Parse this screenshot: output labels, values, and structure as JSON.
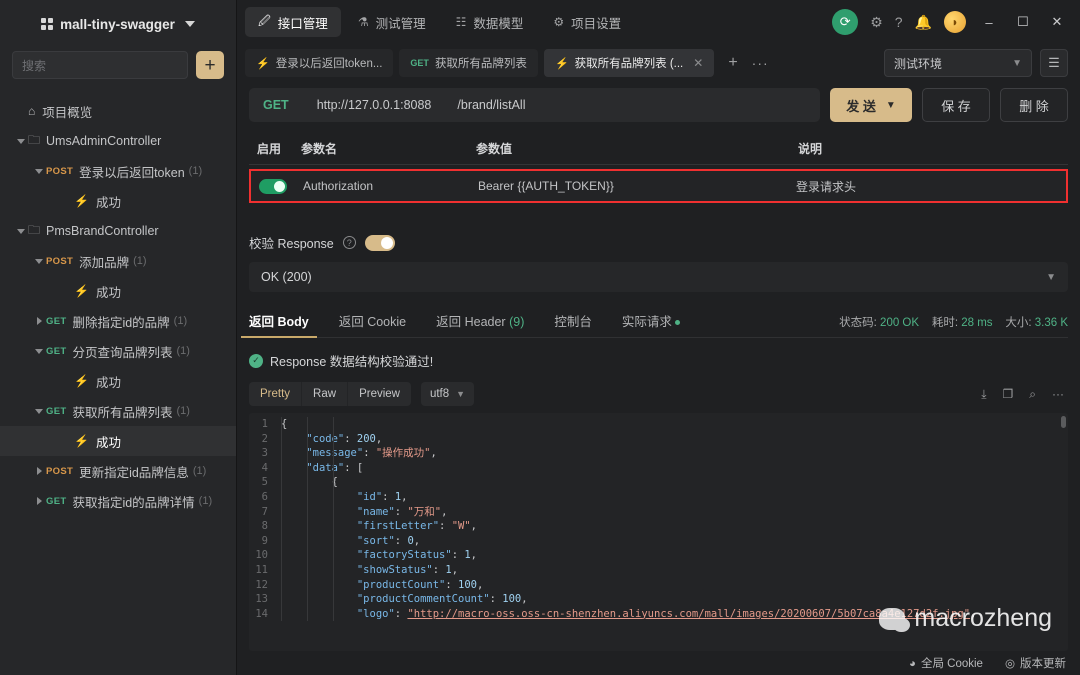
{
  "sidebar": {
    "project_name": "mall-tiny-swagger",
    "search_placeholder": "搜索",
    "add_label": "+",
    "overview_label": "项目概览",
    "tree": [
      {
        "type": "folder",
        "label": "UmsAdminController",
        "indent": 1,
        "arrow": "down"
      },
      {
        "type": "api",
        "method": "POST",
        "label": "登录以后返回token",
        "count": "(1)",
        "indent": 2,
        "arrow": "down"
      },
      {
        "type": "case",
        "label": "成功",
        "indent": 3,
        "arrow": "none"
      },
      {
        "type": "folder",
        "label": "PmsBrandController",
        "indent": 1,
        "arrow": "down"
      },
      {
        "type": "api",
        "method": "POST",
        "label": "添加品牌",
        "count": "(1)",
        "indent": 2,
        "arrow": "down"
      },
      {
        "type": "case",
        "label": "成功",
        "indent": 3,
        "arrow": "none"
      },
      {
        "type": "api",
        "method": "GET",
        "label": "删除指定id的品牌",
        "count": "(1)",
        "indent": 2,
        "arrow": "right"
      },
      {
        "type": "api",
        "method": "GET",
        "label": "分页查询品牌列表",
        "count": "(1)",
        "indent": 2,
        "arrow": "down"
      },
      {
        "type": "case",
        "label": "成功",
        "indent": 3,
        "arrow": "none"
      },
      {
        "type": "api",
        "method": "GET",
        "label": "获取所有品牌列表",
        "count": "(1)",
        "indent": 2,
        "arrow": "down"
      },
      {
        "type": "case",
        "label": "成功",
        "indent": 3,
        "arrow": "none",
        "selected": true
      },
      {
        "type": "api",
        "method": "POST",
        "label": "更新指定id品牌信息",
        "count": "(1)",
        "indent": 2,
        "arrow": "right"
      },
      {
        "type": "api",
        "method": "GET",
        "label": "获取指定id的品牌详情",
        "count": "(1)",
        "indent": 2,
        "arrow": "right"
      }
    ]
  },
  "topnav": {
    "items": [
      {
        "label": "接口管理",
        "icon": "link-icon",
        "active": true
      },
      {
        "label": "测试管理",
        "icon": "flask-icon",
        "active": false
      },
      {
        "label": "数据模型",
        "icon": "model-icon",
        "active": false
      },
      {
        "label": "项目设置",
        "icon": "gear-icon",
        "active": false
      }
    ],
    "window": {
      "minimize": "–",
      "maximize": "☐",
      "close": "✕"
    }
  },
  "doctabs": {
    "tabs": [
      {
        "label": "登录以后返回token...",
        "kind": "case",
        "active": false,
        "closable": false
      },
      {
        "label": "获取所有品牌列表",
        "kind": "get",
        "method": "GET",
        "active": false,
        "closable": false
      },
      {
        "label": "获取所有品牌列表 (...",
        "kind": "case",
        "active": true,
        "closable": true
      }
    ],
    "add_label": "+",
    "more_label": "···",
    "environment": "测试环境"
  },
  "request": {
    "method": "GET",
    "host": "http://127.0.0.1:8088",
    "path": "/brand/listAll",
    "send_label": "发 送",
    "save_label": "保 存",
    "delete_label": "删 除"
  },
  "params": {
    "headers": [
      "启用",
      "参数名",
      "参数值",
      "说明"
    ],
    "rows": [
      {
        "enabled": true,
        "name": "Authorization",
        "value": "Bearer {{AUTH_TOKEN}}",
        "desc": "登录请求头",
        "highlight": true
      }
    ],
    "highlight_color": "#f03030"
  },
  "validate": {
    "label": "校验 Response",
    "enabled": true,
    "selected_status": "OK (200)"
  },
  "response": {
    "tabs": [
      {
        "label": "返回 Body",
        "active": true
      },
      {
        "label": "返回 Cookie",
        "active": false
      },
      {
        "label": "返回 Header",
        "count": "(9)",
        "active": false
      },
      {
        "label": "控制台",
        "active": false
      },
      {
        "label": "实际请求",
        "dot": true,
        "active": false
      }
    ],
    "stats": {
      "status_label": "状态码:",
      "status_value": "200 OK",
      "time_label": "耗时:",
      "time_value": "28 ms",
      "size_label": "大小:",
      "size_value": "3.36 K"
    },
    "pass_message": "Response 数据结构校验通过!",
    "viewer": {
      "modes": [
        "Pretty",
        "Raw",
        "Preview"
      ],
      "active_mode": "Pretty",
      "encoding": "utf8",
      "icons": [
        "download-icon",
        "copy-icon",
        "search-icon",
        "more-icon"
      ]
    },
    "body_lines": [
      {
        "n": 1,
        "indent": 0,
        "tokens": [
          {
            "t": "p",
            "v": "{"
          }
        ]
      },
      {
        "n": 2,
        "indent": 1,
        "tokens": [
          {
            "t": "k",
            "v": "\"code\""
          },
          {
            "t": "p",
            "v": ": "
          },
          {
            "t": "n",
            "v": "200"
          },
          {
            "t": "p",
            "v": ","
          }
        ]
      },
      {
        "n": 3,
        "indent": 1,
        "tokens": [
          {
            "t": "k",
            "v": "\"message\""
          },
          {
            "t": "p",
            "v": ": "
          },
          {
            "t": "s",
            "v": "\"操作成功\""
          },
          {
            "t": "p",
            "v": ","
          }
        ]
      },
      {
        "n": 4,
        "indent": 1,
        "tokens": [
          {
            "t": "k",
            "v": "\"data\""
          },
          {
            "t": "p",
            "v": ": ["
          }
        ]
      },
      {
        "n": 5,
        "indent": 2,
        "tokens": [
          {
            "t": "p",
            "v": "{"
          }
        ]
      },
      {
        "n": 6,
        "indent": 3,
        "tokens": [
          {
            "t": "k",
            "v": "\"id\""
          },
          {
            "t": "p",
            "v": ": "
          },
          {
            "t": "n",
            "v": "1"
          },
          {
            "t": "p",
            "v": ","
          }
        ]
      },
      {
        "n": 7,
        "indent": 3,
        "tokens": [
          {
            "t": "k",
            "v": "\"name\""
          },
          {
            "t": "p",
            "v": ": "
          },
          {
            "t": "s",
            "v": "\"万和\""
          },
          {
            "t": "p",
            "v": ","
          }
        ]
      },
      {
        "n": 8,
        "indent": 3,
        "tokens": [
          {
            "t": "k",
            "v": "\"firstLetter\""
          },
          {
            "t": "p",
            "v": ": "
          },
          {
            "t": "s",
            "v": "\"W\""
          },
          {
            "t": "p",
            "v": ","
          }
        ]
      },
      {
        "n": 9,
        "indent": 3,
        "tokens": [
          {
            "t": "k",
            "v": "\"sort\""
          },
          {
            "t": "p",
            "v": ": "
          },
          {
            "t": "n",
            "v": "0"
          },
          {
            "t": "p",
            "v": ","
          }
        ]
      },
      {
        "n": 10,
        "indent": 3,
        "tokens": [
          {
            "t": "k",
            "v": "\"factoryStatus\""
          },
          {
            "t": "p",
            "v": ": "
          },
          {
            "t": "n",
            "v": "1"
          },
          {
            "t": "p",
            "v": ","
          }
        ]
      },
      {
        "n": 11,
        "indent": 3,
        "tokens": [
          {
            "t": "k",
            "v": "\"showStatus\""
          },
          {
            "t": "p",
            "v": ": "
          },
          {
            "t": "n",
            "v": "1"
          },
          {
            "t": "p",
            "v": ","
          }
        ]
      },
      {
        "n": 12,
        "indent": 3,
        "tokens": [
          {
            "t": "k",
            "v": "\"productCount\""
          },
          {
            "t": "p",
            "v": ": "
          },
          {
            "t": "n",
            "v": "100"
          },
          {
            "t": "p",
            "v": ","
          }
        ]
      },
      {
        "n": 13,
        "indent": 3,
        "tokens": [
          {
            "t": "k",
            "v": "\"productCommentCount\""
          },
          {
            "t": "p",
            "v": ": "
          },
          {
            "t": "n",
            "v": "100"
          },
          {
            "t": "p",
            "v": ","
          }
        ]
      },
      {
        "n": 14,
        "indent": 3,
        "tokens": [
          {
            "t": "k",
            "v": "\"logo\""
          },
          {
            "t": "p",
            "v": ": "
          },
          {
            "t": "u",
            "v": "\"http://macro-oss.oss-cn-shenzhen.aliyuncs.com/mall/images/20200607/5b07ca8a4e127d2f.jpg\""
          },
          {
            "t": "p",
            "v": ","
          }
        ]
      }
    ]
  },
  "footer": {
    "cookie_label": "全局 Cookie",
    "version_label": "版本更新"
  },
  "watermark": {
    "text": "macrozheng"
  }
}
